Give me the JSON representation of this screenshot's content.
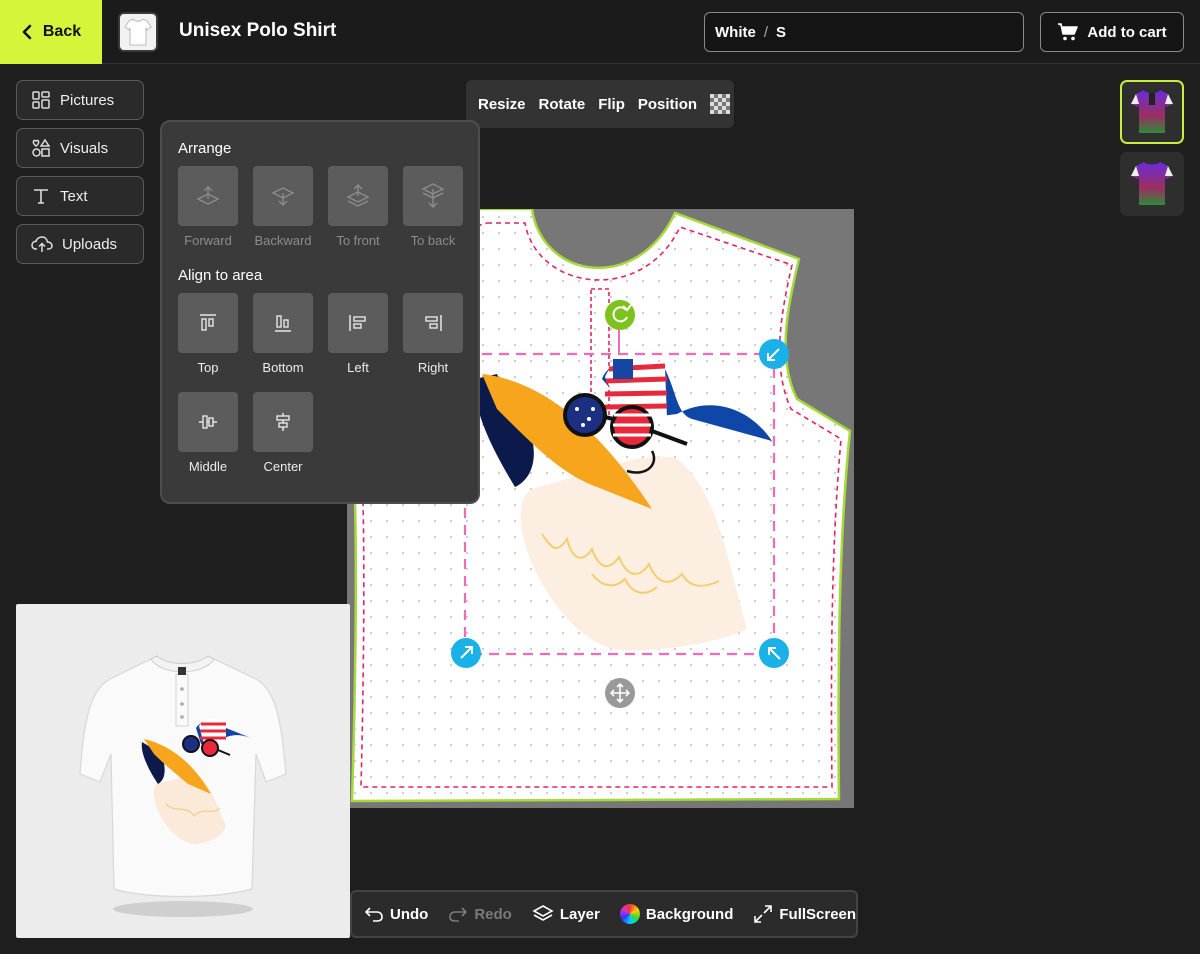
{
  "header": {
    "back_label": "Back",
    "title": "Unisex Polo Shirt",
    "variant": {
      "color": "White",
      "separator": "/",
      "size": "S"
    },
    "cart_label": "Add to cart"
  },
  "sidebar": {
    "items": [
      {
        "label": "Pictures",
        "icon": "grid-icon"
      },
      {
        "label": "Visuals",
        "icon": "shapes-icon"
      },
      {
        "label": "Text",
        "icon": "text-icon"
      },
      {
        "label": "Uploads",
        "icon": "cloud-upload-icon"
      }
    ]
  },
  "toolbar": {
    "resize": "Resize",
    "rotate": "Rotate",
    "flip": "Flip",
    "position": "Position",
    "transparency_icon": "checkerboard-icon"
  },
  "arrange_panel": {
    "arrange_title": "Arrange",
    "arrange_items": [
      {
        "label": "Forward",
        "icon": "layer-forward-icon"
      },
      {
        "label": "Backward",
        "icon": "layer-backward-icon"
      },
      {
        "label": "To front",
        "icon": "layer-to-front-icon"
      },
      {
        "label": "To back",
        "icon": "layer-to-back-icon"
      }
    ],
    "align_title": "Align to area",
    "align_items": [
      {
        "label": "Top",
        "icon": "align-top-icon"
      },
      {
        "label": "Bottom",
        "icon": "align-bottom-icon"
      },
      {
        "label": "Left",
        "icon": "align-left-icon"
      },
      {
        "label": "Right",
        "icon": "align-right-icon"
      },
      {
        "label": "Middle",
        "icon": "align-middle-icon"
      },
      {
        "label": "Center",
        "icon": "align-center-icon"
      }
    ]
  },
  "bottom_bar": {
    "undo": "Undo",
    "redo": "Redo",
    "layer": "Layer",
    "background": "Background",
    "fullscreen": "FullScreen"
  },
  "colors": {
    "accent": "#d4f539",
    "handle": "#1ab0e8",
    "rotate_handle": "#7cc31e",
    "cut_line": "#e0245e",
    "shirt_outline": "#a6d93a",
    "selection": "#f06ab8"
  }
}
